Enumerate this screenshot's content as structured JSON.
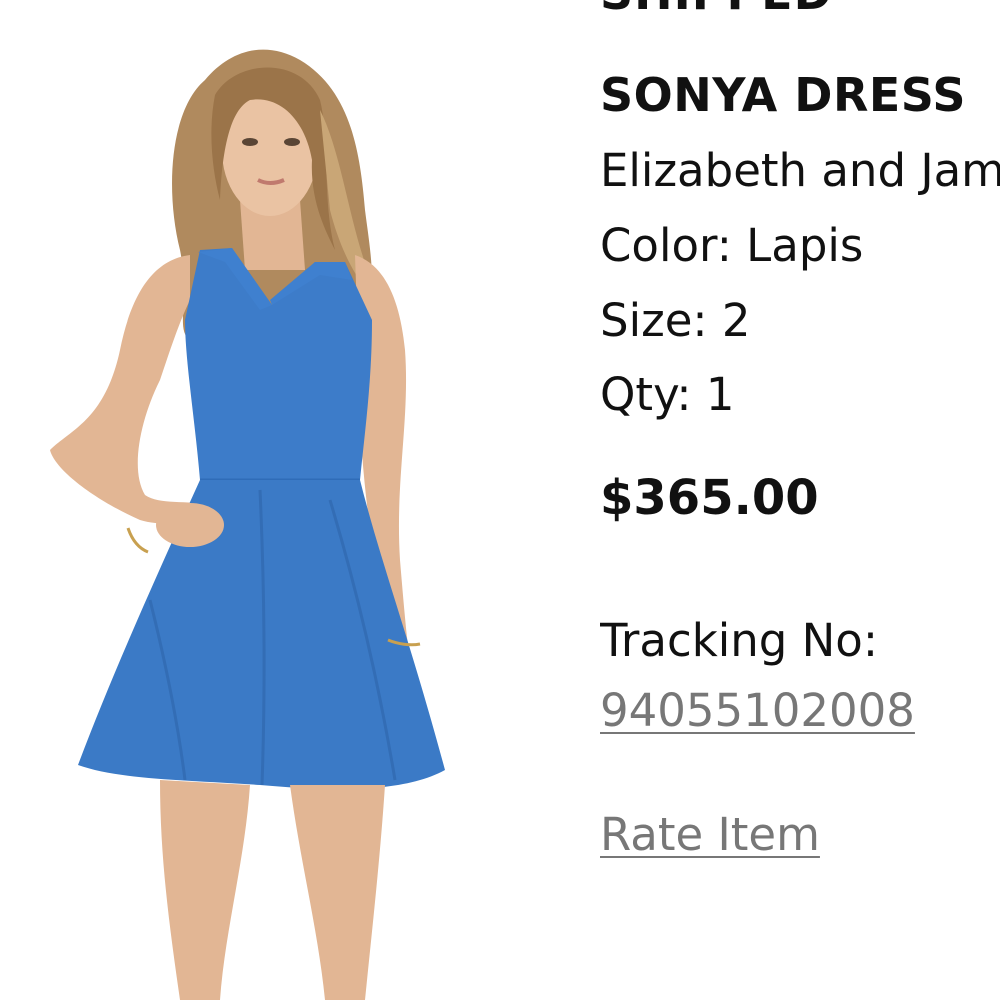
{
  "order_item": {
    "status": "SHIPPED",
    "product_name": "SONYA DRESS",
    "brand": "Elizabeth and James",
    "color_label": "Color:",
    "color_value": "Lapis",
    "size_label": "Size:",
    "size_value": "2",
    "qty_label": "Qty:",
    "qty_value": "1",
    "price": "$365.00",
    "tracking_label": "Tracking No:",
    "tracking_number": "94055102008",
    "rate_item_label": "Rate Item"
  },
  "colors": {
    "dress": "#3d7cc9",
    "link": "#777777",
    "text": "#111111"
  }
}
